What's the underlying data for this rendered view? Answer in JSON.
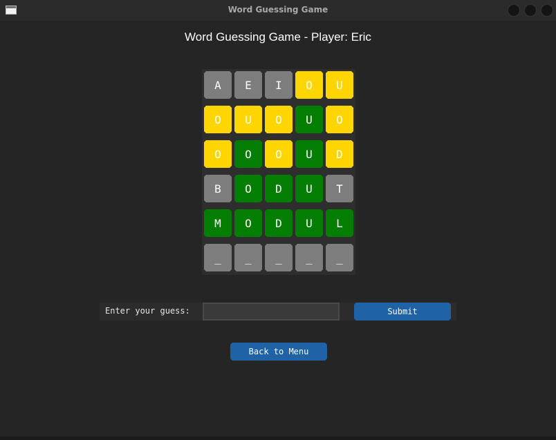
{
  "window": {
    "title": "Word Guessing Game",
    "controls": [
      "minimize",
      "maximize",
      "close"
    ]
  },
  "game": {
    "title": "Word Guessing Game - Player: Eric",
    "colors": {
      "gray": "#7d7d7d",
      "yellow": "#ffd500",
      "green": "#037e03"
    },
    "rows": [
      [
        {
          "letter": "A",
          "state": "gray"
        },
        {
          "letter": "E",
          "state": "gray"
        },
        {
          "letter": "I",
          "state": "gray"
        },
        {
          "letter": "O",
          "state": "yellow"
        },
        {
          "letter": "U",
          "state": "yellow"
        }
      ],
      [
        {
          "letter": "O",
          "state": "yellow"
        },
        {
          "letter": "U",
          "state": "yellow"
        },
        {
          "letter": "O",
          "state": "yellow"
        },
        {
          "letter": "U",
          "state": "green"
        },
        {
          "letter": "O",
          "state": "yellow"
        }
      ],
      [
        {
          "letter": "O",
          "state": "yellow"
        },
        {
          "letter": "O",
          "state": "green"
        },
        {
          "letter": "O",
          "state": "yellow"
        },
        {
          "letter": "U",
          "state": "green"
        },
        {
          "letter": "D",
          "state": "yellow"
        }
      ],
      [
        {
          "letter": "B",
          "state": "gray"
        },
        {
          "letter": "O",
          "state": "green"
        },
        {
          "letter": "D",
          "state": "green"
        },
        {
          "letter": "U",
          "state": "green"
        },
        {
          "letter": "T",
          "state": "gray"
        }
      ],
      [
        {
          "letter": "M",
          "state": "green"
        },
        {
          "letter": "O",
          "state": "green"
        },
        {
          "letter": "D",
          "state": "green"
        },
        {
          "letter": "U",
          "state": "green"
        },
        {
          "letter": "L",
          "state": "green"
        }
      ],
      [
        {
          "letter": "_",
          "state": "gray"
        },
        {
          "letter": "_",
          "state": "gray"
        },
        {
          "letter": "_",
          "state": "gray"
        },
        {
          "letter": "_",
          "state": "gray"
        },
        {
          "letter": "_",
          "state": "gray"
        }
      ]
    ]
  },
  "guess": {
    "label": "Enter your guess:",
    "value": "",
    "placeholder": "",
    "submit_label": "Submit"
  },
  "menu": {
    "back_label": "Back to Menu"
  }
}
